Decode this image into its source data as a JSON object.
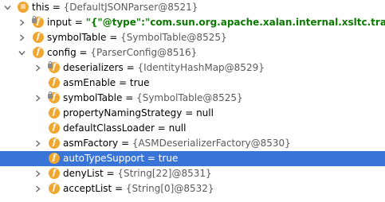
{
  "tree": {
    "rows": [
      {
        "name": "this",
        "value": "{DefaultJSONParser@8521}",
        "value_style": "ref",
        "depth": 0,
        "expanded": true,
        "has_arrow": true,
        "icon": "object-icon",
        "selected": false
      },
      {
        "name": "input",
        "value": "\"{\"@type\":\"com.sun.org.apache.xalan.internal.xsltc.trax.Tem",
        "value_style": "string",
        "depth": 1,
        "expanded": false,
        "has_arrow": true,
        "icon": "field-icon",
        "locked": true,
        "selected": false
      },
      {
        "name": "symbolTable",
        "value": "{SymbolTable@8525}",
        "value_style": "ref",
        "depth": 1,
        "expanded": false,
        "has_arrow": true,
        "icon": "field-icon",
        "locked": false,
        "selected": false
      },
      {
        "name": "config",
        "value": "{ParserConfig@8516}",
        "value_style": "ref",
        "depth": 1,
        "expanded": true,
        "has_arrow": true,
        "icon": "field-icon",
        "locked": false,
        "selected": false
      },
      {
        "name": "deserializers",
        "value": "{IdentityHashMap@8529}",
        "value_style": "ref",
        "depth": 2,
        "expanded": false,
        "has_arrow": true,
        "icon": "field-icon",
        "locked": true,
        "selected": false
      },
      {
        "name": "asmEnable",
        "value": "true",
        "value_style": "plain",
        "depth": 2,
        "expanded": false,
        "has_arrow": false,
        "icon": "field-icon",
        "locked": false,
        "selected": false
      },
      {
        "name": "symbolTable",
        "value": "{SymbolTable@8525}",
        "value_style": "ref",
        "depth": 2,
        "expanded": false,
        "has_arrow": true,
        "icon": "field-icon",
        "locked": true,
        "selected": false
      },
      {
        "name": "propertyNamingStrategy",
        "value": "null",
        "value_style": "plain",
        "depth": 2,
        "expanded": false,
        "has_arrow": false,
        "icon": "field-icon",
        "locked": false,
        "selected": false
      },
      {
        "name": "defaultClassLoader",
        "value": "null",
        "value_style": "plain",
        "depth": 2,
        "expanded": false,
        "has_arrow": false,
        "icon": "field-icon",
        "locked": false,
        "selected": false
      },
      {
        "name": "asmFactory",
        "value": "{ASMDeserializerFactory@8530}",
        "value_style": "ref",
        "depth": 2,
        "expanded": false,
        "has_arrow": true,
        "icon": "field-icon",
        "locked": false,
        "selected": false
      },
      {
        "name": "autoTypeSupport",
        "value": "true",
        "value_style": "plain",
        "depth": 2,
        "expanded": false,
        "has_arrow": false,
        "icon": "field-icon",
        "locked": false,
        "selected": true
      },
      {
        "name": "denyList",
        "value": "{String[22]@8531}",
        "value_style": "ref",
        "depth": 2,
        "expanded": false,
        "has_arrow": true,
        "icon": "field-icon",
        "locked": false,
        "selected": false
      },
      {
        "name": "acceptList",
        "value": "{String[0]@8532}",
        "value_style": "ref",
        "depth": 2,
        "expanded": false,
        "has_arrow": true,
        "icon": "field-icon",
        "locked": false,
        "selected": false
      }
    ]
  },
  "colors": {
    "selection": "#3875d7",
    "field_icon": "#f0a732",
    "string_value": "#0b7a00",
    "ref_value": "#5a5a5a"
  },
  "glyphs": {
    "equals": "=",
    "field_icon_letter": "f",
    "object_icon_symbol": "≡"
  }
}
